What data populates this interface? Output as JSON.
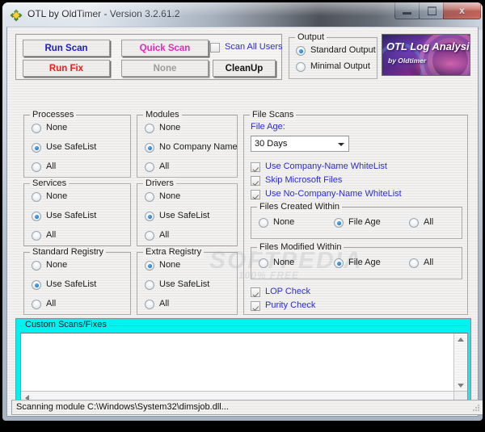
{
  "window": {
    "title": "OTL by OldTimer - Version 3.2.61.2",
    "icon": "otl-diamond-icon",
    "minimize_label": "",
    "maximize_label": "",
    "close_label": "x"
  },
  "toolbar": {
    "run_scan_label": "Run Scan",
    "quick_scan_label": "Quick Scan",
    "run_fix_label": "Run Fix",
    "none_label": "None",
    "cleanup_label": "CleanUp",
    "scan_all_users_label": "Scan All Users",
    "scan_all_users_checked": false
  },
  "output": {
    "legend": "Output",
    "options": [
      {
        "label": "Standard Output",
        "selected": true
      },
      {
        "label": "Minimal Output",
        "selected": false
      }
    ]
  },
  "logo": {
    "line1": "OTL Log Analysis",
    "line2": "by Oldtimer"
  },
  "groups": [
    {
      "legend": "Processes",
      "options": [
        {
          "label": "None",
          "selected": false
        },
        {
          "label": "Use SafeList",
          "selected": true
        },
        {
          "label": "All",
          "selected": false
        }
      ]
    },
    {
      "legend": "Services",
      "options": [
        {
          "label": "None",
          "selected": false
        },
        {
          "label": "Use SafeList",
          "selected": true
        },
        {
          "label": "All",
          "selected": false
        }
      ]
    },
    {
      "legend": "Standard Registry",
      "options": [
        {
          "label": "None",
          "selected": false
        },
        {
          "label": "Use SafeList",
          "selected": true
        },
        {
          "label": "All",
          "selected": false
        }
      ]
    },
    {
      "legend": "Modules",
      "options": [
        {
          "label": "None",
          "selected": false
        },
        {
          "label": "No Company Name",
          "selected": true
        },
        {
          "label": "All",
          "selected": false
        }
      ]
    },
    {
      "legend": "Drivers",
      "options": [
        {
          "label": "None",
          "selected": false
        },
        {
          "label": "Use SafeList",
          "selected": true
        },
        {
          "label": "All",
          "selected": false
        }
      ]
    },
    {
      "legend": "Extra Registry",
      "options": [
        {
          "label": "None",
          "selected": true
        },
        {
          "label": "Use SafeList",
          "selected": false
        },
        {
          "label": "All",
          "selected": false
        }
      ]
    }
  ],
  "file_scans": {
    "legend": "File Scans",
    "file_age_label": "File Age:",
    "file_age_value": "30 Days",
    "checks": [
      {
        "label": "Use Company-Name WhiteList",
        "checked": true
      },
      {
        "label": "Skip Microsoft Files",
        "checked": true
      },
      {
        "label": "Use No-Company-Name WhiteList",
        "checked": true
      }
    ],
    "files_created": {
      "legend": "Files Created Within",
      "options": [
        {
          "label": "None",
          "selected": false
        },
        {
          "label": "File Age",
          "selected": true
        },
        {
          "label": "All",
          "selected": false
        }
      ]
    },
    "files_modified": {
      "legend": "Files Modified Within",
      "options": [
        {
          "label": "None",
          "selected": false
        },
        {
          "label": "File Age",
          "selected": true
        },
        {
          "label": "All",
          "selected": false
        }
      ]
    },
    "extra_checks": [
      {
        "label": "LOP Check",
        "checked": true
      },
      {
        "label": "Purity Check",
        "checked": true
      }
    ]
  },
  "custom_scans": {
    "legend": "Custom Scans/Fixes",
    "text": ""
  },
  "statusbar": {
    "text": "Scanning module C:\\Windows\\System32\\dimsjob.dll..."
  },
  "watermark": {
    "line1": "SOFTPEDIA",
    "line2": "100% FREE"
  },
  "colors": {
    "accent_cyan": "#00f2f2",
    "link_blue": "#2b2bd4",
    "run_scan": "#1919d0",
    "quick_scan": "#ea24c0",
    "run_fix": "#ec1c16"
  }
}
